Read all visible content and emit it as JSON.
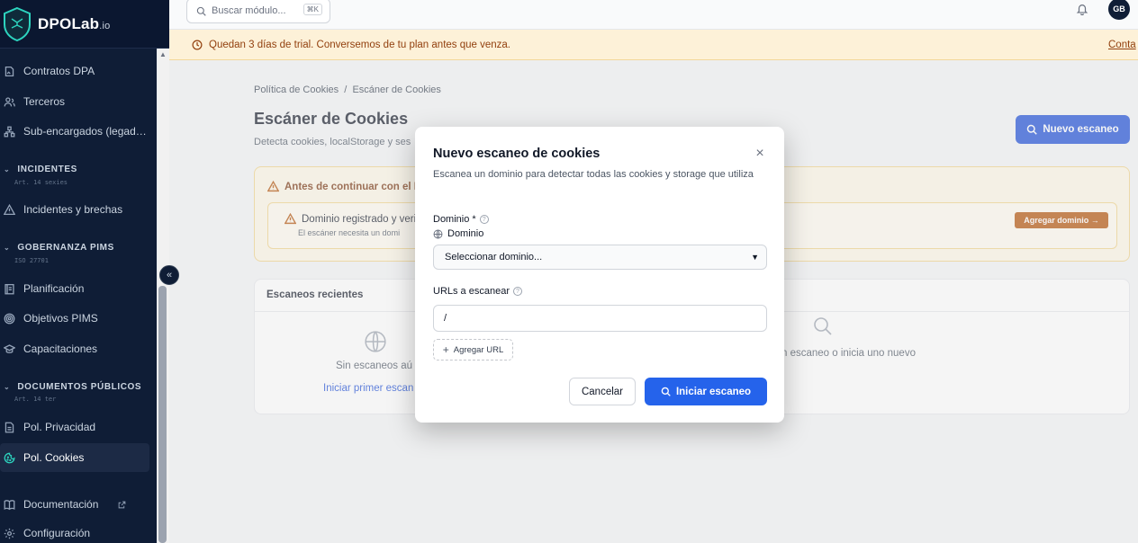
{
  "brand": {
    "name": "DPOLab",
    "suffix": ".io"
  },
  "sidebar": {
    "items": [
      {
        "label": "Contratos DPA",
        "icon": "file-signature-icon"
      },
      {
        "label": "Terceros",
        "icon": "users-icon"
      },
      {
        "label": "Sub-encargados (legad…",
        "icon": "network-icon"
      },
      {
        "label": "Incidentes y brechas",
        "icon": "warning-icon"
      },
      {
        "label": "Planificación",
        "icon": "clipboard-icon"
      },
      {
        "label": "Objetivos PIMS",
        "icon": "target-icon"
      },
      {
        "label": "Capacitaciones",
        "icon": "graduation-cap-icon"
      },
      {
        "label": "Pol. Privacidad",
        "icon": "document-icon"
      },
      {
        "label": "Pol. Cookies",
        "icon": "cookie-icon",
        "active": true
      },
      {
        "label": "Documentación",
        "icon": "book-icon"
      },
      {
        "label": "Configuración",
        "icon": "gear-icon"
      }
    ],
    "sections": [
      {
        "title": "INCIDENTES",
        "sub": "Art. 14 sexies"
      },
      {
        "title": "GOBERNANZA PIMS",
        "sub": "ISO 27701"
      },
      {
        "title": "DOCUMENTOS PÚBLICOS",
        "sub": "Art. 14 ter"
      }
    ]
  },
  "topbar": {
    "search_placeholder": "Buscar módulo...",
    "shortcut": "⌘K",
    "avatar_initials": "GB"
  },
  "trial": {
    "message": "Quedan 3 días de trial. Conversemos de tu plan antes que venza.",
    "link": "Conta"
  },
  "main": {
    "breadcrumb": "Política de Cookies  /  Escáner de Cookies",
    "title": "Escáner de Cookies",
    "subtitle": "Detecta cookies, localStorage y ses",
    "new_scan_label": "Nuevo escaneo",
    "warning": {
      "title": "Antes de continuar con el E",
      "row_title": "Dominio registrado y veri",
      "row_sub": "El escáner necesita un domi",
      "action": "Agregar dominio →"
    },
    "recent": {
      "title": "Escaneos recientes",
      "empty_text": "Sin escaneos aú",
      "empty_link": "Iniciar primer escan",
      "empty_text_2": "n escaneo o inicia uno nuevo"
    }
  },
  "modal": {
    "title": "Nuevo escaneo de cookies",
    "description": "Escanea un dominio para detectar todas las cookies y storage que utiliza",
    "domain_label": "Dominio *",
    "domain_sub": "Dominio",
    "domain_select_value": "Seleccionar dominio...",
    "urls_label": "URLs a escanear",
    "url_value": "/",
    "add_url_label": "Agregar URL",
    "cancel_label": "Cancelar",
    "start_label": "Iniciar escaneo"
  },
  "colors": {
    "sidebar_bg": "#0f1d36",
    "primary": "#2563eb",
    "warning_bg": "#fef7e6",
    "accent_amber": "#b45309"
  }
}
